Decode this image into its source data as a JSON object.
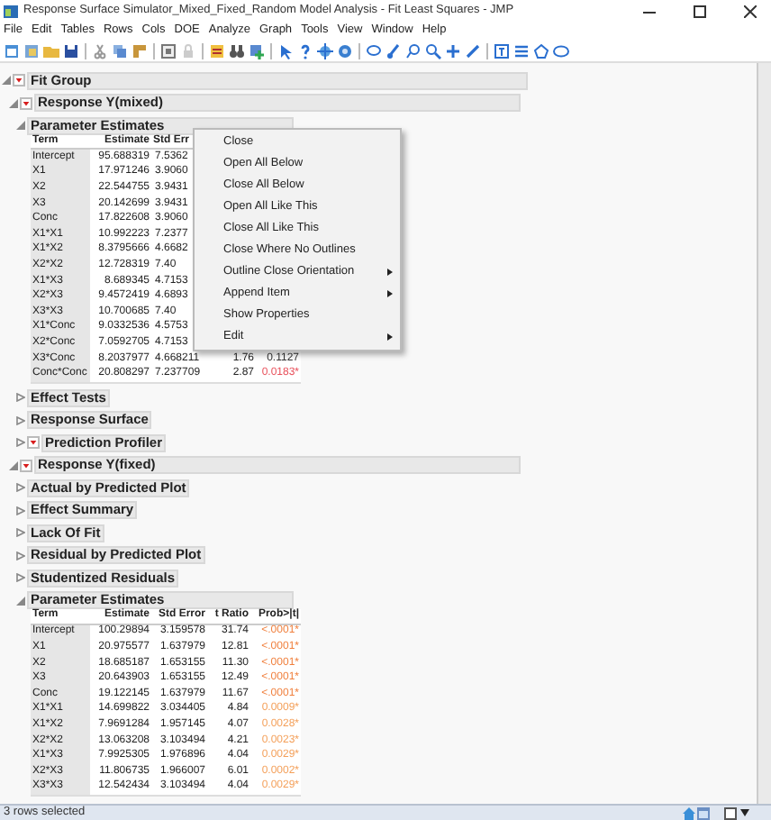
{
  "window": {
    "title": "Response Surface Simulator_Mixed_Fixed_Random Model Analysis - Fit Least Squares - JMP"
  },
  "menu_bar": [
    "File",
    "Edit",
    "Tables",
    "Rows",
    "Cols",
    "DOE",
    "Analyze",
    "Graph",
    "Tools",
    "View",
    "Window",
    "Help"
  ],
  "outline": [
    {
      "title": "Fit Group",
      "expanded": true,
      "hotspot": true,
      "children": [
        {
          "title": "Response Y(mixed)",
          "expanded": true,
          "hotspot": true,
          "children": [
            {
              "title": "Parameter Estimates",
              "expanded": true,
              "hotspot": false,
              "table": {
                "columns": [
                  "Term",
                  "Estimate",
                  "Std Err"
                ],
                "rows": [
                  {
                    "term": "Intercept",
                    "estimate": "95.688319",
                    "std_error": "7.5362"
                  },
                  {
                    "term": "X1",
                    "estimate": "17.971246",
                    "std_error": "3.9060"
                  },
                  {
                    "term": "X2",
                    "estimate": "22.544755",
                    "std_error": "3.9431"
                  },
                  {
                    "term": "X3",
                    "estimate": "20.142699",
                    "std_error": "3.9431"
                  },
                  {
                    "term": "Conc",
                    "estimate": "17.822608",
                    "std_error": "3.9060"
                  },
                  {
                    "term": "X1*X1",
                    "estimate": "10.992223",
                    "std_error": "7.2377"
                  },
                  {
                    "term": "X1*X2",
                    "estimate": "8.3795666",
                    "std_error": "4.6682"
                  },
                  {
                    "term": "X2*X2",
                    "estimate": "12.728319",
                    "std_error": "7.40"
                  },
                  {
                    "term": "X1*X3",
                    "estimate": "8.689345",
                    "std_error": "4.7153"
                  },
                  {
                    "term": "X2*X3",
                    "estimate": "9.4572419",
                    "std_error": "4.6893"
                  },
                  {
                    "term": "X3*X3",
                    "estimate": "10.700685",
                    "std_error": "7.40"
                  },
                  {
                    "term": "X1*Conc",
                    "estimate": "9.0332536",
                    "std_error": "4.5753"
                  },
                  {
                    "term": "X2*Conc",
                    "estimate": "7.0592705",
                    "std_error": "4.7153"
                  },
                  {
                    "term": "X3*Conc",
                    "estimate": "8.2037977",
                    "std_error": "4.668211",
                    "t_ratio": "1.76",
                    "prob": "0.1127",
                    "color": "#333333"
                  },
                  {
                    "term": "Conc*Conc",
                    "estimate": "20.808297",
                    "std_error": "7.237709",
                    "t_ratio": "2.87",
                    "prob": "0.0183*",
                    "color": "#e8505b"
                  }
                ]
              }
            },
            {
              "title": "Effect Tests",
              "expanded": false,
              "hotspot": false
            },
            {
              "title": "Response Surface",
              "expanded": false,
              "hotspot": false
            },
            {
              "title": "Prediction Profiler",
              "expanded": false,
              "hotspot": true
            }
          ]
        },
        {
          "title": "Response Y(fixed)",
          "expanded": true,
          "hotspot": true,
          "children": [
            {
              "title": "Actual by Predicted Plot",
              "expanded": false,
              "hotspot": false
            },
            {
              "title": "Effect Summary",
              "expanded": false,
              "hotspot": false
            },
            {
              "title": "Lack Of Fit",
              "expanded": false,
              "hotspot": false
            },
            {
              "title": "Residual by Predicted Plot",
              "expanded": false,
              "hotspot": false
            },
            {
              "title": "Studentized Residuals",
              "expanded": false,
              "hotspot": false
            },
            {
              "title": "Parameter Estimates",
              "expanded": true,
              "hotspot": false,
              "table": {
                "columns": [
                  "Term",
                  "Estimate",
                  "Std Error",
                  "t Ratio",
                  "Prob>|t|"
                ],
                "rows": [
                  {
                    "term": "Intercept",
                    "estimate": "100.29894",
                    "std_error": "3.159578",
                    "t_ratio": "31.74",
                    "prob": "<.0001*",
                    "color": "#f07f3c"
                  },
                  {
                    "term": "X1",
                    "estimate": "20.975577",
                    "std_error": "1.637979",
                    "t_ratio": "12.81",
                    "prob": "<.0001*",
                    "color": "#f07f3c"
                  },
                  {
                    "term": "X2",
                    "estimate": "18.685187",
                    "std_error": "1.653155",
                    "t_ratio": "11.30",
                    "prob": "<.0001*",
                    "color": "#f07f3c"
                  },
                  {
                    "term": "X3",
                    "estimate": "20.643903",
                    "std_error": "1.653155",
                    "t_ratio": "12.49",
                    "prob": "<.0001*",
                    "color": "#f07f3c"
                  },
                  {
                    "term": "Conc",
                    "estimate": "19.122145",
                    "std_error": "1.637979",
                    "t_ratio": "11.67",
                    "prob": "<.0001*",
                    "color": "#f07f3c"
                  },
                  {
                    "term": "X1*X1",
                    "estimate": "14.699822",
                    "std_error": "3.034405",
                    "t_ratio": "4.84",
                    "prob": "0.0009*",
                    "color": "#f4a05a"
                  },
                  {
                    "term": "X1*X2",
                    "estimate": "7.9691284",
                    "std_error": "1.957145",
                    "t_ratio": "4.07",
                    "prob": "0.0028*",
                    "color": "#f4a05a"
                  },
                  {
                    "term": "X2*X2",
                    "estimate": "13.063208",
                    "std_error": "3.103494",
                    "t_ratio": "4.21",
                    "prob": "0.0023*",
                    "color": "#f4a05a"
                  },
                  {
                    "term": "X1*X3",
                    "estimate": "7.9925305",
                    "std_error": "1.976896",
                    "t_ratio": "4.04",
                    "prob": "0.0029*",
                    "color": "#f4a05a"
                  },
                  {
                    "term": "X2*X3",
                    "estimate": "11.806735",
                    "std_error": "1.966007",
                    "t_ratio": "6.01",
                    "prob": "0.0002*",
                    "color": "#f4a05a"
                  },
                  {
                    "term": "X3*X3",
                    "estimate": "12.542434",
                    "std_error": "3.103494",
                    "t_ratio": "4.04",
                    "prob": "0.0029*",
                    "color": "#f4a05a"
                  }
                ]
              }
            }
          ]
        }
      ]
    }
  ],
  "context_menu": {
    "items": [
      {
        "label": "Close",
        "submenu": false
      },
      {
        "label": "Open All Below",
        "submenu": false
      },
      {
        "label": "Close All Below",
        "submenu": false
      },
      {
        "label": "Open All Like This",
        "submenu": false
      },
      {
        "label": "Close All Like This",
        "submenu": false
      },
      {
        "label": "Close Where No Outlines",
        "submenu": false
      },
      {
        "label": "Outline Close Orientation",
        "submenu": true
      },
      {
        "label": "Append Item",
        "submenu": true
      },
      {
        "label": "Show Properties",
        "submenu": false
      },
      {
        "label": "Edit",
        "submenu": true
      }
    ]
  },
  "status_bar": {
    "text": "3 rows selected"
  }
}
